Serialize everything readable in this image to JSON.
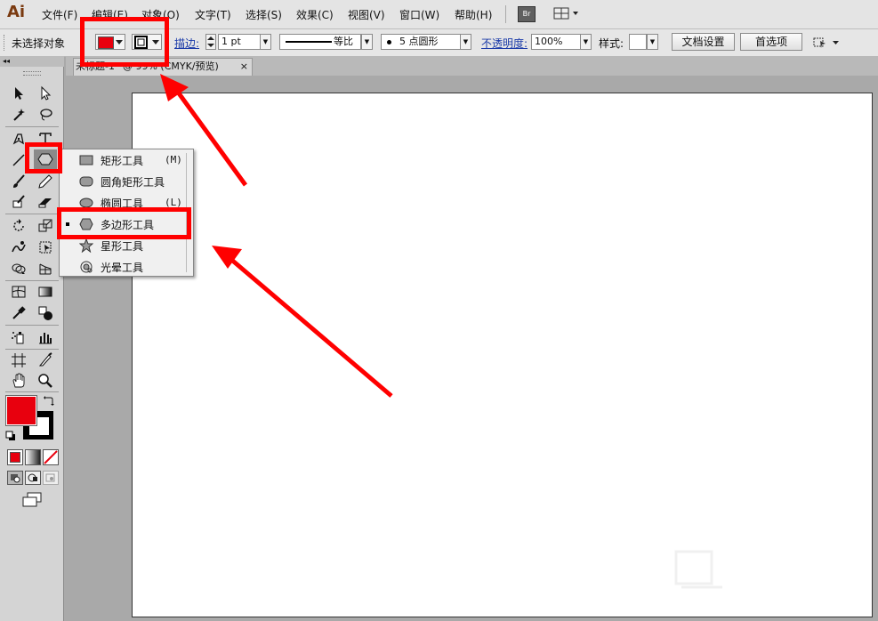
{
  "app": {
    "logo": "Ai"
  },
  "menubar": {
    "items": [
      "文件(F)",
      "编辑(E)",
      "对象(O)",
      "文字(T)",
      "选择(S)",
      "效果(C)",
      "视图(V)",
      "窗口(W)",
      "帮助(H)"
    ],
    "bridge_label": "Br"
  },
  "controlbar": {
    "selection_status": "未选择对象",
    "stroke_label": "描边:",
    "stroke_weight": "1 pt",
    "stroke_profile": "等比",
    "brush": "5 点圆形",
    "opacity_label": "不透明度:",
    "opacity": "100%",
    "style_label": "样式:",
    "doc_setup": "文档设置",
    "preferences": "首选项"
  },
  "colors": {
    "fill": "#e8000e",
    "annotation": "#ff0000",
    "canvas": "#a9a9a9"
  },
  "document": {
    "tab_title": "未标题-1* @ 99% (CMYK/预览)",
    "close_symbol": "×"
  },
  "toolbox": {
    "collapse_label": "◂◂"
  },
  "flyout": {
    "items": [
      {
        "label": "矩形工具",
        "shortcut": "(M)",
        "icon": "rectangle-icon"
      },
      {
        "label": "圆角矩形工具",
        "shortcut": "",
        "icon": "rounded-rectangle-icon"
      },
      {
        "label": "椭圆工具",
        "shortcut": "(L)",
        "icon": "ellipse-icon"
      },
      {
        "label": "多边形工具",
        "shortcut": "",
        "icon": "polygon-icon",
        "selected": true
      },
      {
        "label": "星形工具",
        "shortcut": "",
        "icon": "star-icon"
      },
      {
        "label": "光晕工具",
        "shortcut": "",
        "icon": "flare-icon"
      }
    ]
  }
}
